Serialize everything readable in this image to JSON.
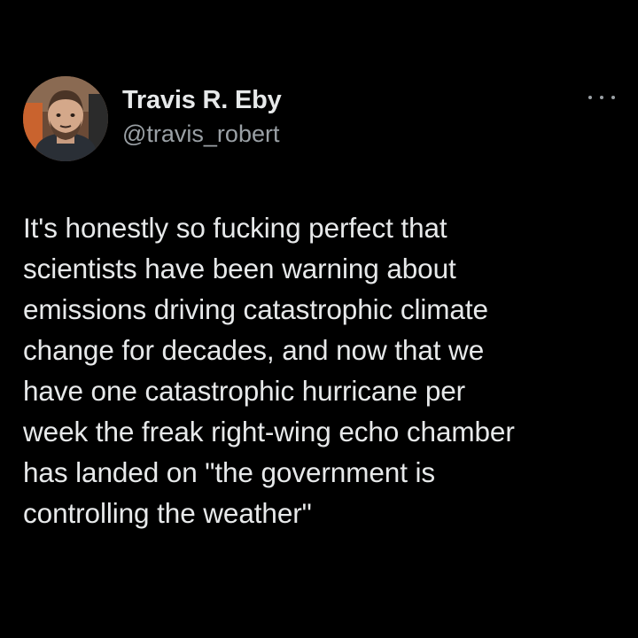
{
  "post": {
    "author": {
      "display_name": "Travis R. Eby",
      "handle": "@travis_robert"
    },
    "text": "It's honestly so fucking perfect that\nscientists have been warning about\nemissions driving catastrophic climate\nchange for decades, and now that we\nhave one catastrophic hurricane per\nweek the freak right-wing echo chamber\nhas landed on \"the government is\ncontrolling the weather\""
  },
  "icons": {
    "avatar": "profile-photo",
    "more": "more-horizontal-icon"
  },
  "colors": {
    "background": "#000000",
    "primary_text": "#e7e9ea",
    "secondary_text": "#9aa0a5"
  }
}
